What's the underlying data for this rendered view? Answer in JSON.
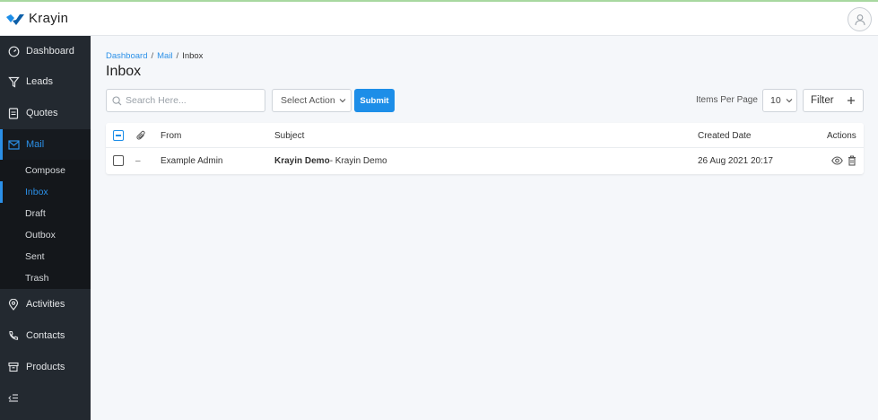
{
  "app": {
    "name": "Krayin",
    "accent": "#2b90e8",
    "sidebar_bg": "#232930"
  },
  "sidebar": {
    "items": [
      {
        "label": "Dashboard",
        "icon": "dashboard-icon"
      },
      {
        "label": "Leads",
        "icon": "filter-icon"
      },
      {
        "label": "Quotes",
        "icon": "document-icon"
      },
      {
        "label": "Mail",
        "icon": "mail-icon"
      },
      {
        "label": "Activities",
        "icon": "location-pin-icon"
      },
      {
        "label": "Contacts",
        "icon": "phone-icon"
      },
      {
        "label": "Products",
        "icon": "archive-box-icon"
      }
    ],
    "mail_submenu": [
      "Compose",
      "Inbox",
      "Draft",
      "Outbox",
      "Sent",
      "Trash"
    ]
  },
  "breadcrumb": {
    "items": [
      "Dashboard",
      "Mail",
      "Inbox"
    ],
    "separator": "/"
  },
  "page_title": "Inbox",
  "toolbar": {
    "search_placeholder": "Search Here...",
    "select_action": "Select Action",
    "submit_label": "Submit",
    "items_per_page_label": "Items Per Page",
    "items_per_page_value": "10",
    "filter_label": "Filter"
  },
  "table": {
    "headers": {
      "from": "From",
      "subject": "Subject",
      "created_date": "Created Date",
      "actions": "Actions"
    },
    "rows": [
      {
        "attachment": "–",
        "from": "Example Admin",
        "subject_bold": "Krayin Demo",
        "subject_rest": "- Krayin Demo",
        "created_date": "26 Aug 2021 20:17"
      }
    ]
  }
}
